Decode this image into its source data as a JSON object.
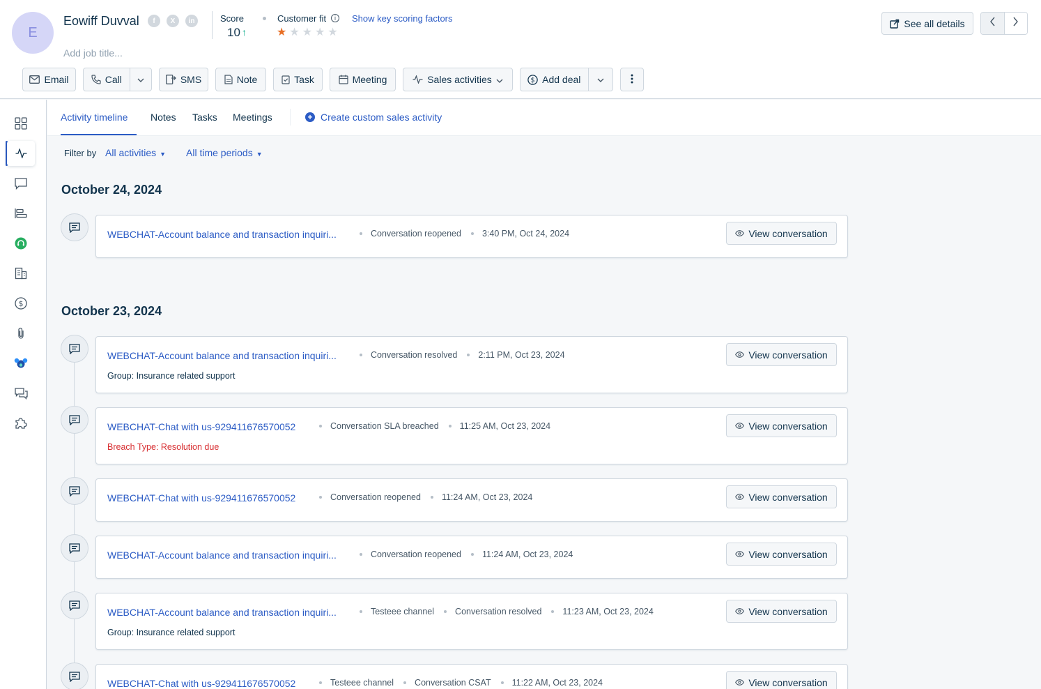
{
  "contact": {
    "avatar_initial": "E",
    "name": "Eowiff Duvval",
    "job_title_placeholder": "Add job title...",
    "socials": [
      "facebook-icon",
      "x-icon",
      "linkedin-icon"
    ],
    "score_label": "Score",
    "score_value": "10",
    "customer_fit_label": "Customer fit",
    "customer_fit_rating": 1,
    "customer_fit_max": 5,
    "key_factors_link": "Show key scoring factors",
    "see_all_details": "See all details"
  },
  "toolbar": {
    "email": "Email",
    "call": "Call",
    "sms": "SMS",
    "note": "Note",
    "task": "Task",
    "meeting": "Meeting",
    "sales_activities": "Sales activities",
    "add_deal": "Add deal"
  },
  "tabs": {
    "activity_timeline": "Activity timeline",
    "notes": "Notes",
    "tasks": "Tasks",
    "meetings": "Meetings",
    "create_custom": "Create custom sales activity"
  },
  "filters": {
    "label": "Filter by",
    "activities": "All activities",
    "time_periods": "All time periods"
  },
  "timeline": {
    "date1": "October 24, 2024",
    "date2": "October 23, 2024",
    "view_label": "View conversation",
    "cards": [
      {
        "title": "WEBCHAT-Account balance and transaction inquiri...",
        "meta": [
          "Conversation reopened",
          "3:40 PM, Oct 24, 2024"
        ],
        "sub": ""
      },
      {
        "title": "WEBCHAT-Account balance and transaction inquiri...",
        "meta": [
          "Conversation resolved",
          "2:11 PM, Oct 23, 2024"
        ],
        "sub": "Group: Insurance related support"
      },
      {
        "title": "WEBCHAT-Chat with us-929411676570052",
        "meta": [
          "Conversation SLA breached",
          "11:25 AM, Oct 23, 2024"
        ],
        "sub": "Breach Type: Resolution due"
      },
      {
        "title": "WEBCHAT-Chat with us-929411676570052",
        "meta": [
          "Conversation reopened",
          "11:24 AM, Oct 23, 2024"
        ],
        "sub": ""
      },
      {
        "title": "WEBCHAT-Account balance and transaction inquiri...",
        "meta": [
          "Conversation reopened",
          "11:24 AM, Oct 23, 2024"
        ],
        "sub": ""
      },
      {
        "title": "WEBCHAT-Account balance and transaction inquiri...",
        "meta": [
          "Testeee channel",
          "Conversation resolved",
          "11:23 AM, Oct 23, 2024"
        ],
        "sub": "Group: Insurance related support"
      },
      {
        "title": "WEBCHAT-Chat with us-929411676570052",
        "meta": [
          "Testeee channel",
          "Conversation CSAT",
          "11:22 AM, Oct 23, 2024"
        ],
        "sub": ""
      }
    ]
  },
  "colors": {
    "accent": "#2c5cc5",
    "text": "#12344d",
    "breach": "#d72d30",
    "star_on": "#e86f25",
    "score_up": "#00a886"
  }
}
